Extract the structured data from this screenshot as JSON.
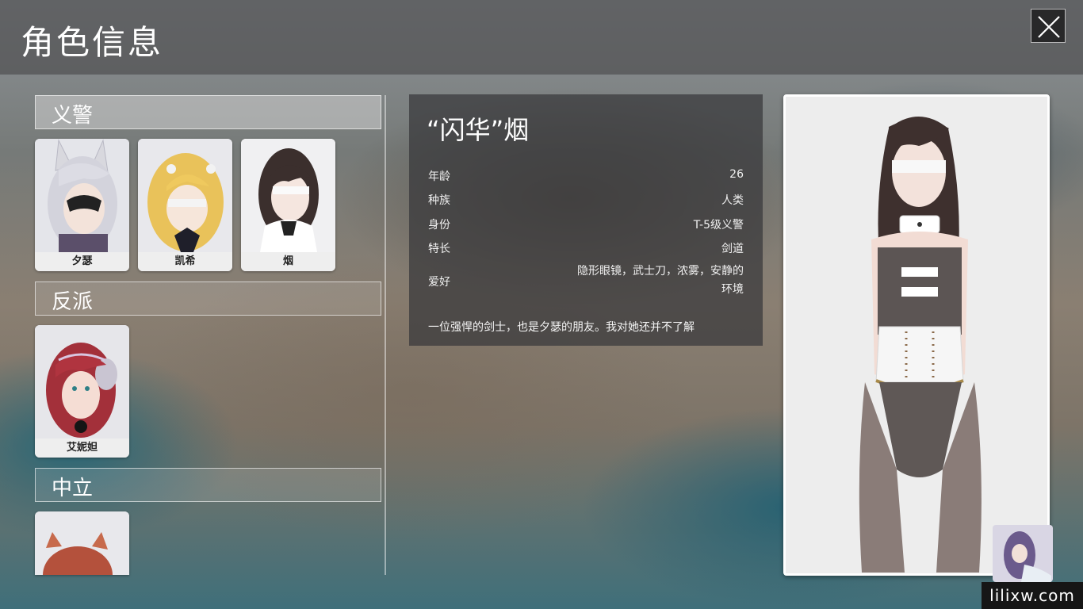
{
  "window": {
    "title": "角色信息",
    "close_icon": "close-icon"
  },
  "sections": [
    {
      "label": "义警",
      "characters": [
        {
          "name": "夕瑟",
          "selected": false
        },
        {
          "name": "凯希",
          "selected": false
        },
        {
          "name": "烟",
          "selected": true
        }
      ]
    },
    {
      "label": "反派",
      "characters": [
        {
          "name": "艾妮妲",
          "selected": false
        }
      ]
    },
    {
      "label": "中立",
      "characters": [
        {
          "name": "",
          "selected": false
        }
      ]
    }
  ],
  "detail": {
    "name": "“闪华”烟",
    "rows": [
      {
        "label": "年龄",
        "value": "26"
      },
      {
        "label": "种族",
        "value": "人类"
      },
      {
        "label": "身份",
        "value": "T-5级义警"
      },
      {
        "label": "特长",
        "value": "剑道"
      },
      {
        "label": "爱好",
        "value": "隐形眼镜，武士刀，浓雾，安静的环境"
      }
    ],
    "description": "一位强悍的剑士，也是夕瑟的朋友。我对她还并不了解"
  },
  "watermark": "lilixw.com",
  "colors": {
    "panel": "#37373a",
    "card_bg": "#e9eaee",
    "frame_border": "#ffffff"
  }
}
